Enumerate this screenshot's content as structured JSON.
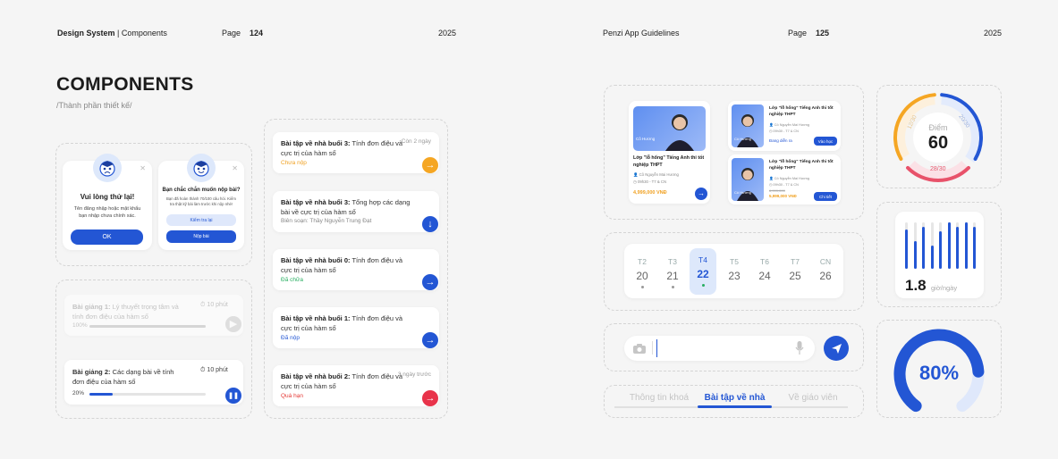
{
  "header_left": {
    "brand": "Design System",
    "separator": "|",
    "section": "Components",
    "page_label": "Page",
    "page_number": "124",
    "year": "2025"
  },
  "header_right": {
    "title": "Penzi App Guidelines",
    "page_label": "Page",
    "page_number": "125",
    "year": "2025"
  },
  "page_title": "COMPONENTS",
  "page_subtitle": "/Thành phần thiết kế/",
  "dialogs": [
    {
      "title": "Vui lòng thử lại!",
      "text": "Tên đăng nhập hoặc mật khẩu bạn nhập chưa chính xác.",
      "ok_label": "OK"
    },
    {
      "title": "Bạn chắc chắn muốn nộp bài?",
      "text": "Bạn đã hoàn thành 70/100 câu hỏi. Kiểm tra thật kỹ bài làm trước khi nộp nhé!",
      "check_label": "Kiểm tra lại",
      "submit_label": "Nộp bài"
    }
  ],
  "lectures": [
    {
      "prefix": "Bài giảng 1:",
      "title": "Lý thuyết trọng tâm và tính đơn điệu của hàm số",
      "duration": "10 phút",
      "progress_text": "100%",
      "progress": 1.0
    },
    {
      "prefix": "Bài giảng 2:",
      "title": "Các dạng bài về tính đơn điệu của hàm số",
      "duration": "10 phút",
      "progress_text": "20%",
      "progress": 0.2
    }
  ],
  "homework": [
    {
      "prefix": "Bài tập về nhà buổi 3:",
      "title": "Tính đơn điệu và cực trị của hàm số",
      "meta": "Còn 2 ngày",
      "status": "Chưa nộp",
      "status_color": "#f0a020",
      "btn_color": "#f5a623",
      "icon": "arrow-right-icon"
    },
    {
      "prefix": "Bài tập về nhà buổi 3:",
      "title": "Tổng hợp các dạng bài về cực trị của hàm số",
      "meta": "",
      "status": "Biên soạn: Thầy Nguyễn Trung Đạt",
      "status_color": "#888888",
      "btn_color": "#2356d4",
      "icon": "download-icon"
    },
    {
      "prefix": "Bài tập về nhà buổi 0:",
      "title": "Tính đơn điệu và cực trị của hàm số",
      "meta": "",
      "status": "Đã chữa",
      "status_color": "#27ae60",
      "btn_color": "#2356d4",
      "icon": "arrow-right-icon"
    },
    {
      "prefix": "Bài tập về nhà buổi 1:",
      "title": "Tính đơn điệu và cực trị của hàm số",
      "meta": "",
      "status": "Đã nộp",
      "status_color": "#2356d4",
      "btn_color": "#2356d4",
      "icon": "arrow-right-icon"
    },
    {
      "prefix": "Bài tập về nhà buổi 2:",
      "title": "Tính đơn điệu và cực trị của hàm số",
      "meta": "3 ngày trước",
      "status": "Quá hạn",
      "status_color": "#e53935",
      "btn_color": "#e8334a",
      "icon": "arrow-right-icon"
    }
  ],
  "course_big": {
    "teacher_tag": "Cô Hương",
    "title": "Lớp \"lỗ hổng\" Tiếng Anh thi tốt nghiệp THPT",
    "teacher": "Cô Nguyễn Mai Hương",
    "schedule": "09h30 - T7 & CN",
    "price": "4,999,000 VNĐ"
  },
  "course_small": [
    {
      "teacher_tag": "Cô Hương",
      "title": "Lớp \"lỗ hổng\" Tiếng Anh thi tốt nghiệp THPT",
      "teacher": "Cô Nguyễn Mai Hương",
      "schedule": "09h30 - T7 & CN",
      "status": "Đang diễn ra",
      "button": "Vào học"
    },
    {
      "teacher_tag": "Cô Hương",
      "title": "Lớp \"lỗ hổng\" Tiếng Anh thi tốt nghiệp THPT",
      "teacher": "Cô Nguyễn Mai Hương",
      "schedule": "09h30 - T7 & CN",
      "old_price": "6,999,000",
      "price": "5,999,000 VNĐ",
      "button": "Chi tiết"
    }
  ],
  "calendar": [
    {
      "name": "T2",
      "date": "20",
      "dot": true
    },
    {
      "name": "T3",
      "date": "21",
      "dot": true
    },
    {
      "name": "T4",
      "date": "22",
      "dot": true,
      "selected": true
    },
    {
      "name": "T5",
      "date": "23",
      "dot": false
    },
    {
      "name": "T6",
      "date": "24",
      "dot": false
    },
    {
      "name": "T7",
      "date": "25",
      "dot": false
    },
    {
      "name": "CN",
      "date": "26",
      "dot": false
    }
  ],
  "chat_input": {
    "value": "",
    "placeholder": ""
  },
  "tabs": [
    {
      "label": "Thông tin khoá",
      "active": false
    },
    {
      "label": "Bài tập về nhà",
      "active": true
    },
    {
      "label": "Về giáo viên",
      "active": false
    }
  ],
  "score_gauge": {
    "label": "Điểm",
    "value": "60",
    "segments": [
      "12/30",
      "20/30",
      "28/30"
    ],
    "colors": {
      "orange": "#f5a623",
      "blue": "#2356d4",
      "red": "#e8526a"
    }
  },
  "study_chart": {
    "value": "1.8",
    "unit": "giờ/ngày",
    "bars": [
      0.85,
      0.6,
      0.9,
      0.5,
      0.8,
      1.0,
      0.9,
      1.0,
      0.9
    ]
  },
  "progress_ring": {
    "value": "80%",
    "fraction": 0.8
  },
  "colors": {
    "brand": "#2356d4",
    "background": "#f5f5f5"
  }
}
